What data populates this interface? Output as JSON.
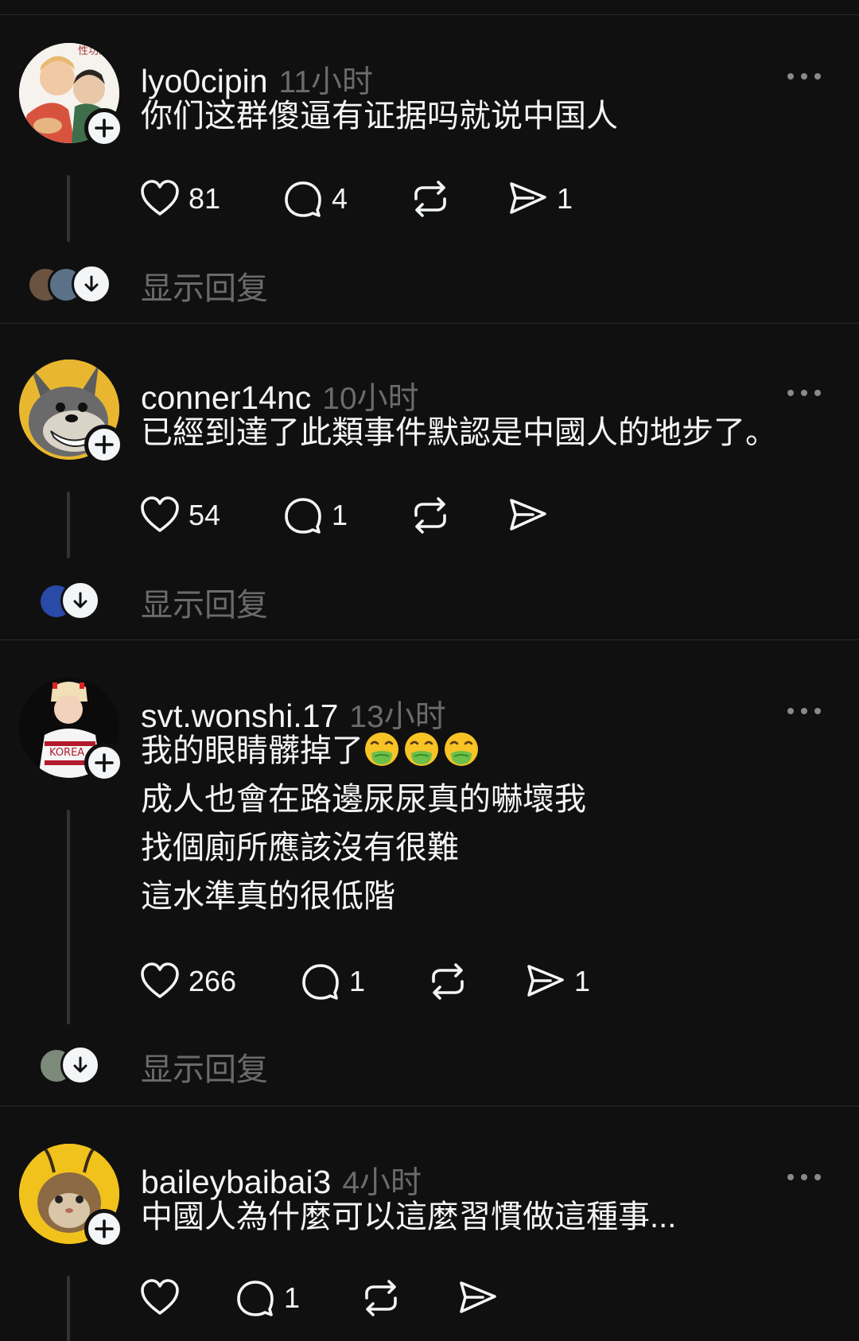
{
  "posts": [
    {
      "username": "lyo0cipin",
      "time": "11小时",
      "lines": [
        "你们这群傻逼有证据吗就说中国人"
      ],
      "likes": "81",
      "comments": "4",
      "shares": "1",
      "show_replies": "显示回复",
      "avatar_text": "性功的"
    },
    {
      "username": "conner14nc",
      "time": "10小时",
      "lines": [
        "已經到達了此類事件默認是中國人的地步了。"
      ],
      "likes": "54",
      "comments": "1",
      "shares": "",
      "show_replies": "显示回复"
    },
    {
      "username": "svt.wonshi.17",
      "time": "13小时",
      "line1_text": "我的眼睛髒掉了",
      "emoji": [
        "nauseated-face",
        "nauseated-face",
        "nauseated-face"
      ],
      "lines": [
        "成人也會在路邊尿尿真的嚇壞我",
        "找個廁所應該沒有很難",
        "這水準真的很低階"
      ],
      "likes": "266",
      "comments": "1",
      "shares": "1",
      "show_replies": "显示回复",
      "avatar_text": "KOREA"
    },
    {
      "username": "baileybaibai3",
      "time": "4小时",
      "lines": [
        "中國人為什麼可以這麼習慣做這種事..."
      ],
      "likes": "",
      "comments": "1",
      "shares": ""
    }
  ],
  "colors": {
    "background": "#101010",
    "text": "#f3f5f7",
    "muted": "#6b6b6b",
    "divider": "#2a2a2a"
  },
  "icons": [
    "heart-icon",
    "comment-icon",
    "repost-icon",
    "send-icon",
    "plus-icon",
    "arrow-down-icon",
    "more-icon"
  ]
}
